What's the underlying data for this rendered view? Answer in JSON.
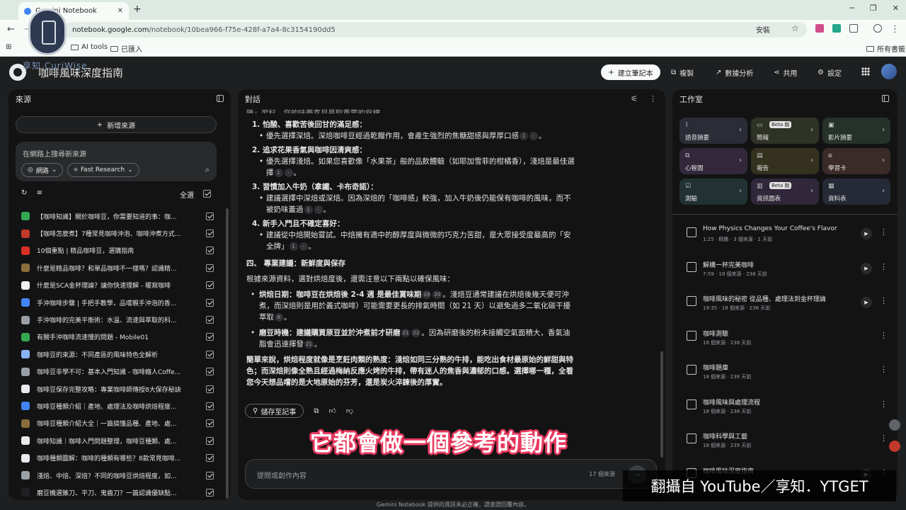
{
  "browser": {
    "tab_title": "Gemini Notebook",
    "url_host": "notebook.google.com",
    "url_path": "/notebook/10bea966-f75e-428f-a7a4-8c3154190dd5",
    "install_label": "安裝",
    "bookmarks": [
      "AI tools",
      "已匯入"
    ],
    "all_bookmarks": "所有書籤"
  },
  "app": {
    "title": "咖啡風味深度指南",
    "new_notebook": "建立筆記本",
    "copy": "複製",
    "analytics": "數據分析",
    "share": "共用",
    "settings": "設定"
  },
  "sources": {
    "heading": "來源",
    "add": "新增來源",
    "search_label": "在網路上搜尋新來源",
    "chip_web": "網路",
    "chip_research": "Fast Research",
    "select_all": "全選",
    "items": [
      {
        "title": "【咖啡知識】關於咖啡豆，你需要知道的事：咖...",
        "color": "#34a853"
      },
      {
        "title": "【咖啡怎麼煮】7種常見咖啡沖泡、咖啡沖煮方式...",
        "color": "#c0392b"
      },
      {
        "title": "10個重點 | 精品咖啡豆，選購指南",
        "color": "#d93025"
      },
      {
        "title": "什麼是精品咖啡？和單品咖啡不一樣嗎？認識精...",
        "color": "#8a6d3b"
      },
      {
        "title": "什麼是SCA金杯理論？讓你快速理解 - 暖窩咖啡",
        "color": "#f1f3f4"
      },
      {
        "title": "手沖咖啡步驟 | 手把手教學，品嚐親手沖泡的香...",
        "color": "#4285f4"
      },
      {
        "title": "手沖咖啡的完美平衡術：水溫、流速與萃取的科...",
        "color": "#9aa0a6"
      },
      {
        "title": "有關手沖咖啡流速慢的問題 - Mobile01",
        "color": "#34a853"
      },
      {
        "title": "咖啡豆的來源：不同產區的風味特色全解析",
        "color": "#8ab4f8"
      },
      {
        "title": "咖啡豆非學不可：基本入門知識 - 咖啡癮人Coffe...",
        "color": "#9aa0a6"
      },
      {
        "title": "咖啡豆保存完整攻略：專業咖啡師傳授8大保存秘訣",
        "color": "#e8eaed"
      },
      {
        "title": "咖啡豆種類介紹｜產地、處理法及咖啡烘焙程度...",
        "color": "#4285f4"
      },
      {
        "title": "咖啡豆種類介紹大全｜一篇搞懂品種、產地、處...",
        "color": "#8a6d3b"
      },
      {
        "title": "咖啡知識｜咖啡入門問題整理，咖啡豆種類、處...",
        "color": "#e8eaed"
      },
      {
        "title": "咖啡種類圖解：咖啡的種類有哪些？8款常見咖啡...",
        "color": "#e8eaed"
      },
      {
        "title": "淺焙、中焙、深焙？不同的咖啡豆烘焙程度，如...",
        "color": "#9aa0a6"
      },
      {
        "title": "磨豆機選錐刀、平刀、鬼齒刀？一篇認識優缺點...",
        "color": "#202124"
      }
    ]
  },
  "chat": {
    "heading": "對話",
    "cut_line": "陳」習科，您的味蕾喜貝是取重要的指標。",
    "list": [
      {
        "num": "1.",
        "title": "怕酸、喜歡苦後回甘的滿足感：",
        "body": "優先選擇深焙。深焙咖啡豆經過乾餾作用，會產生強烈的焦糖甜感與厚厚口感",
        "cites": [
          "1",
          "-"
        ]
      },
      {
        "num": "2.",
        "title": "追求花果香氣與咖啡因清爽感：",
        "body": "優先選擇淺焙。如果您喜歡像「水果茶」般的品飲體驗（如耶加雪菲的柑橘香），淺焙是最佳選擇",
        "cites": [
          "1",
          "-"
        ]
      },
      {
        "num": "3.",
        "title": "習慣加入牛奶（拿鐵、卡布奇諾）：",
        "body": "建議選擇中深焙或深焙。因為深焙的「咖啡感」較強，加入牛奶後仍能保有咖啡的風味，而不被奶味蓋過",
        "cites": [
          "1",
          "-"
        ]
      },
      {
        "num": "4.",
        "title": "新手入門且不確定喜好：",
        "body": "建議從中焙開始嘗試。中焙擁有適中的醇厚度與微微的巧克力苦甜，是大眾接受度最高的「安全牌」",
        "cites": [
          "1",
          "-"
        ]
      }
    ],
    "section_title": "四、 專業建議：新鮮度與保存",
    "section_intro": "根據來源資料，選對烘焙度後，還需注意以下兩點以確保風味：",
    "bullets": [
      {
        "title": "烘焙日期：",
        "body": "咖啡豆在烘焙後 2-4 週 是最佳賞味期",
        "cites1": [
          "19",
          "20"
        ],
        "body2": "。淺焙豆通常建議在烘焙後幾天便可沖煮，而深焙則是用於義式咖啡）可能需要更長的排氣時間（如 21 天）以避免過多二氧化碳干擾萃取",
        "cites2": [
          "8"
        ]
      },
      {
        "title": "磨豆時機：",
        "body": "建議購買原豆並於沖煮前才研磨",
        "cites1": [
          "21",
          "22"
        ],
        "body2": "。因為研磨後的粉末接觸空氣面積大，香氣油脂會迅速揮發",
        "cites2": [
          "21"
        ]
      }
    ],
    "summary": "簡單來說，烘焙程度就像是烹飪肉類的熟度：淺焙如同三分熟的牛排，能吃出食材最原始的鮮甜與特色；而深焙則像全熟且經過梅納反應火烤的牛排，帶有迷人的焦香與濃郁的口感。選擇哪一種，全看您今天想品嚐的是大地原始的芬芳，還是炭火淬鍊後的厚實。",
    "save_note": "儲存至記事",
    "input_placeholder": "提問或創作內容",
    "source_count": "17 個來源"
  },
  "studio": {
    "heading": "工作室",
    "beta": "Beta 版",
    "tiles": [
      {
        "label": "語音摘要",
        "icon": "⌇",
        "bg": "#2a2d36",
        "beta": false
      },
      {
        "label": "簡報",
        "icon": "▭",
        "bg": "#2f3327",
        "beta": true
      },
      {
        "label": "影片摘要",
        "icon": "▣",
        "bg": "#263229",
        "beta": false
      },
      {
        "label": "心智圖",
        "icon": "⧉",
        "bg": "#32283a",
        "beta": false
      },
      {
        "label": "報告",
        "icon": "▤",
        "bg": "#34321f",
        "beta": false
      },
      {
        "label": "學習卡",
        "icon": "⧈",
        "bg": "#3a2b28",
        "beta": false
      },
      {
        "label": "測驗",
        "icon": "☑",
        "bg": "#223234",
        "beta": false
      },
      {
        "label": "資訊圖表",
        "icon": "▥",
        "bg": "#30283a",
        "beta": true
      },
      {
        "label": "資料表",
        "icon": "▦",
        "bg": "#252a36",
        "beta": false
      }
    ],
    "notes": [
      {
        "title": "How Physics Changes Your Coffee's Flavor",
        "meta": "1:25 · 精簡 · 3 個來源 · 1 天前",
        "play": true
      },
      {
        "title": "解構一杯完美咖啡",
        "meta": "7:59 · 18 個來源 · 238 天前",
        "play": true
      },
      {
        "title": "咖啡風味的秘密 從品種、處理法到金杯理論",
        "meta": "19:35 · 18 個來源 · 238 天前",
        "play": true
      },
      {
        "title": "咖啡測驗",
        "meta": "18 個來源 · 238 天前",
        "play": false
      },
      {
        "title": "咖啡題庫",
        "meta": "18 個來源 · 238 天前",
        "play": false
      },
      {
        "title": "咖啡風味與處理流程",
        "meta": "18 個來源 · 238 天前",
        "play": false
      },
      {
        "title": "咖啡科學與工藝",
        "meta": "18 個來源 · 239 天前",
        "play": false
      },
      {
        "title": "咖啡風味深度指南",
        "meta": "",
        "play": true
      }
    ]
  },
  "footer": "Gemini Notebook 提供的資訊未必正確，請查證回覆內容。",
  "overlay": {
    "caption": "它都會做一個參考的動作",
    "watermark": "翻攝自 YouTube／享知．YTGET",
    "logo_text": "享知 CuriWise"
  }
}
